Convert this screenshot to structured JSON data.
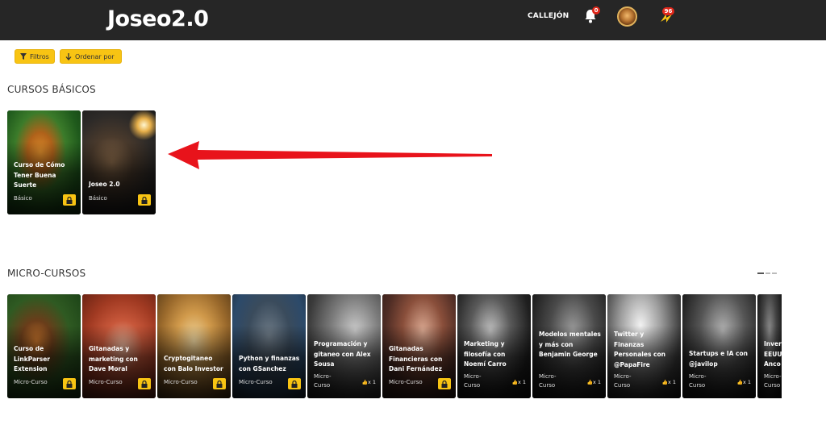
{
  "header": {
    "logo": "Joseo2.0",
    "nav_link": "CALLEJÓN",
    "notifications_count": "0",
    "bolt_count": "96",
    "icons": [
      "bell-icon",
      "avatar",
      "bolt-icon"
    ]
  },
  "toolbar": {
    "filter_label": "Filtros",
    "order_label": "Ordenar por"
  },
  "sections": {
    "basic_title": "CURSOS BÁSICOS",
    "micro_title": "MICRO-CURSOS"
  },
  "basic_courses": [
    {
      "title": "Curso de Cómo Tener Buena Suerte",
      "level": "Básico",
      "locked": true
    },
    {
      "title": "Joseo 2.0",
      "level": "Básico",
      "locked": true
    }
  ],
  "micro_courses": [
    {
      "title": "Curso de LinkParser Extension",
      "level": "Micro-Curso",
      "locked": true
    },
    {
      "title": "Gitanadas y marketing con Dave Moral",
      "level": "Micro-Curso",
      "locked": true
    },
    {
      "title": "Cryptogitaneo con Balo Investor",
      "level": "Micro-Curso",
      "locked": true
    },
    {
      "title": "Python y finanzas con GSanchez",
      "level": "Micro-Curso",
      "locked": true
    },
    {
      "title": "Programación y gitaneo con Alex Sousa",
      "level": "Micro-\nCurso",
      "likes": "x 1"
    },
    {
      "title": "Gitanadas Financieras con Dani Fernández",
      "level": "Micro-Curso",
      "locked": true
    },
    {
      "title": "Marketing y filosofía con Noemí Carro",
      "level": "Micro-\nCurso",
      "likes": "x 1"
    },
    {
      "title": "Modelos mentales y más con Benjamin George",
      "level": "Micro-\nCurso",
      "likes": "x 1"
    },
    {
      "title": "Twitter y Finanzas Personales con @PapaFire",
      "level": "Micro-\nCurso",
      "likes": "x 1"
    },
    {
      "title": "Startups e IA con @javilop",
      "level": "Micro-\nCurso",
      "likes": "x 1"
    },
    {
      "title": "Inver EEUU Anco",
      "level": "Micro-\nCurso"
    }
  ],
  "colors": {
    "header_bg": "#262626",
    "accent": "#f8c413",
    "badge": "#e0281b",
    "arrow": "#e8131b"
  }
}
